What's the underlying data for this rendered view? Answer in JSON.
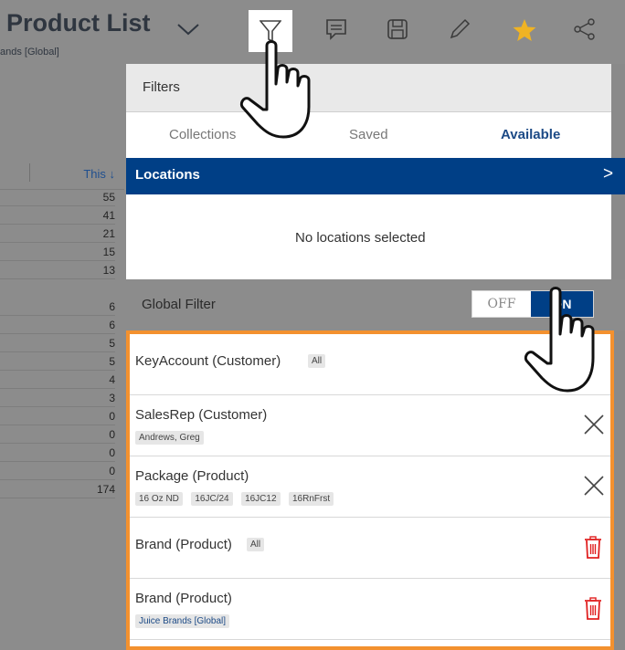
{
  "header": {
    "title": "Product List",
    "subtitle": "ands [Global]"
  },
  "table": {
    "column_label": "This ↓",
    "values": [
      "55",
      "41",
      "21",
      "15",
      "13",
      "6",
      "6",
      "5",
      "5",
      "4",
      "3",
      "0",
      "0",
      "0",
      "0",
      "174"
    ]
  },
  "filters_panel": {
    "heading": "Filters",
    "tabs": [
      "Collections",
      "Saved",
      "Available"
    ],
    "active_tab": "Available",
    "locations": {
      "title": "Locations",
      "arrow": ">",
      "empty_text": "No locations selected"
    },
    "global_filter": {
      "label": "Global Filter",
      "off_label": "OFF",
      "on_label": "ON",
      "state": "ON"
    },
    "items": [
      {
        "name": "KeyAccount (Customer)",
        "inline_chip": "All",
        "chips": [],
        "action": "none"
      },
      {
        "name": "SalesRep (Customer)",
        "chips": [
          "Andrews, Greg"
        ],
        "action": "close-icon"
      },
      {
        "name": "Package (Product)",
        "chips": [
          "16 Oz ND",
          "16JC/24",
          "16JC12",
          "16RnFrst"
        ],
        "action": "close-icon"
      },
      {
        "name": "Brand (Product)",
        "inline_chip": "All",
        "chips": [],
        "action": "trash-icon"
      },
      {
        "name": "Brand (Product)",
        "chips": [
          "Juice Brands [Global]"
        ],
        "action": "trash-icon"
      }
    ]
  },
  "colors": {
    "accent": "#003f86",
    "highlight": "#f3912f",
    "delete": "#e02020",
    "star": "#f0b323"
  }
}
